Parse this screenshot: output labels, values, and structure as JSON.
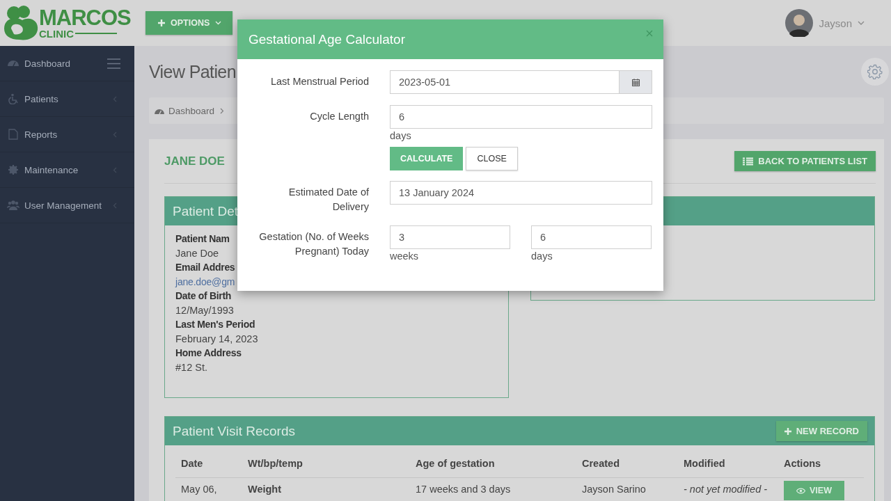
{
  "header": {
    "logo": {
      "title": "MARCOS",
      "subtitle": "CLINIC"
    },
    "options_button": "OPTIONS",
    "user": {
      "name": "Jayson"
    }
  },
  "sidebar": {
    "items": [
      {
        "label": "Dashboard",
        "kind": "dashboard",
        "has_submenu": false
      },
      {
        "label": "Patients",
        "kind": "patients",
        "has_submenu": true
      },
      {
        "label": "Reports",
        "kind": "reports",
        "has_submenu": true
      },
      {
        "label": "Maintenance",
        "kind": "maintenance",
        "has_submenu": true
      },
      {
        "label": "User Management",
        "kind": "users",
        "has_submenu": true
      }
    ]
  },
  "page": {
    "title": "View Patien",
    "breadcrumb": [
      "Dashboard"
    ]
  },
  "patient": {
    "name": "JANE DOE",
    "back_button": "BACK TO PATIENTS LIST"
  },
  "details_panel": {
    "title": "Patient Det",
    "fields": [
      {
        "label": "Patient Nam",
        "value": "Jane Doe",
        "kind": "text"
      },
      {
        "label": "Email Addres",
        "value": "jane.doe@gm",
        "kind": "link"
      },
      {
        "label": "Date of Birth",
        "value": "12/May/1993",
        "kind": "text"
      },
      {
        "label": "Last Men's Period",
        "value": "February 14, 2023",
        "kind": "text"
      },
      {
        "label": "Home Address",
        "value": "#12 St.",
        "kind": "text"
      }
    ]
  },
  "visit_records": {
    "title": "Patient Visit Records",
    "new_button": "NEW RECORD",
    "columns": [
      "Date",
      "Wt/bp/temp",
      "Age of gestation",
      "Created",
      "Modified",
      "Actions"
    ],
    "rows": [
      {
        "date": "May 06,",
        "vitals": "Weight",
        "gestation": "17 weeks and 3 days",
        "created": "Jayson Sarino",
        "modified": "- not yet modified -",
        "action": "VIEW"
      }
    ]
  },
  "modal": {
    "title": "Gestational Age Calculator",
    "lmp": {
      "label": "Last Menstrual Period",
      "value": "2023-05-01"
    },
    "cycle": {
      "label": "Cycle Length",
      "value": "6",
      "unit": "days"
    },
    "buttons": [
      "CALCULATE",
      "CLOSE"
    ],
    "edd": {
      "label": "Estimated Date of Delivery",
      "value": "13 January 2024"
    },
    "gestation": {
      "label": "Gestation (No. of Weeks Pregnant) Today",
      "weeks": {
        "value": "3",
        "unit": "weeks"
      },
      "days": {
        "value": "6",
        "unit": "days"
      }
    }
  }
}
